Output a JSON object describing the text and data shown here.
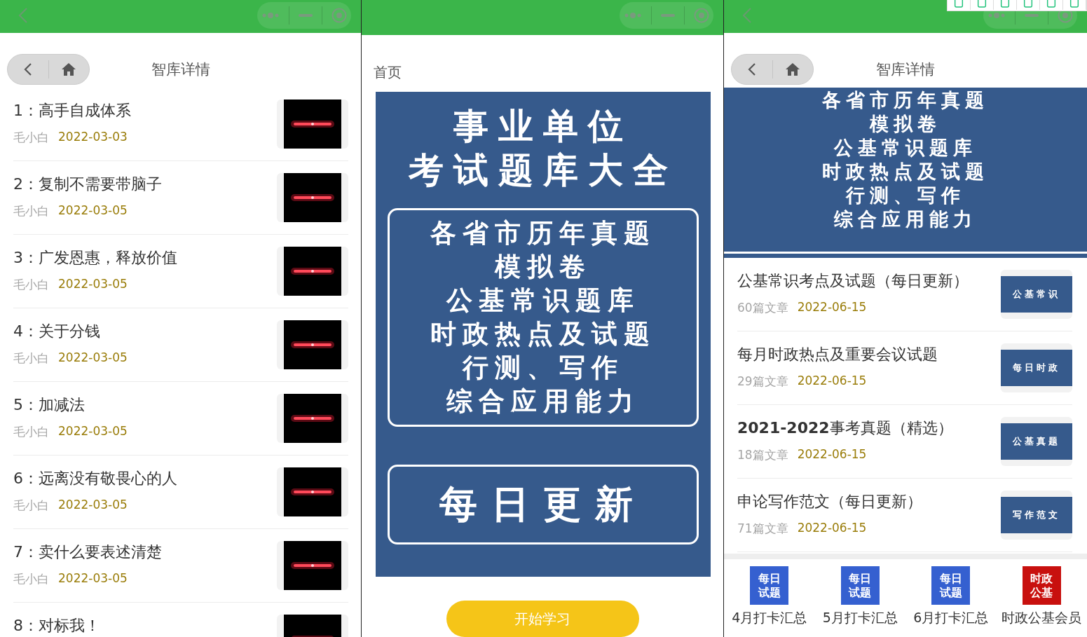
{
  "screens": [
    {
      "kind": "list",
      "nav_title": "智库详情",
      "articles": [
        {
          "title": "1：高手自成体系",
          "author": "毛小白",
          "date": "2022-03-03"
        },
        {
          "title": "2：复制不需要带脑子",
          "author": "毛小白",
          "date": "2022-03-05"
        },
        {
          "title": "3：广发恩惠，释放价值",
          "author": "毛小白",
          "date": "2022-03-05"
        },
        {
          "title": "4：关于分钱",
          "author": "毛小白",
          "date": "2022-03-05"
        },
        {
          "title": "5：加减法",
          "author": "毛小白",
          "date": "2022-03-05"
        },
        {
          "title": "6：远离没有敬畏心的人",
          "author": "毛小白",
          "date": "2022-03-05"
        },
        {
          "title": "7：卖什么要表述清楚",
          "author": "毛小白",
          "date": "2022-03-05"
        },
        {
          "title": "8：对标我！"
        }
      ]
    },
    {
      "kind": "home",
      "page_title": "首页",
      "banner": {
        "headline": [
          "事业单位",
          "考试题库大全"
        ],
        "topics": [
          "各省市历年真题",
          "模拟卷",
          "公基常识题库",
          "时政热点及试题",
          "行测、写作",
          "综合应用能力"
        ],
        "tagline": "每日更新"
      },
      "button": "开始学习"
    },
    {
      "kind": "catalog",
      "nav_title": "智库详情",
      "banner_lines": [
        "各省市历年真题",
        "模拟卷",
        "公基常识题库",
        "时政热点及试题",
        "行测、写作",
        "综合应用能力"
      ],
      "columns": [
        {
          "title": "公基常识考点及试题（每日更新）",
          "count": "60篇文章",
          "date": "2022-06-15",
          "cover": "公基常识"
        },
        {
          "title": "每月时政热点及重要会议试题",
          "count": "29篇文章",
          "date": "2022-06-15",
          "cover": "每日时政"
        },
        {
          "title": "**2021-2022**事考真题（精选）",
          "count": "18篇文章",
          "date": "2022-06-15",
          "cover": "公基真题"
        },
        {
          "title": "申论写作范文（每日更新）",
          "count": "71篇文章",
          "date": "2022-06-15",
          "cover": "写作范文"
        }
      ],
      "shortcuts": [
        {
          "icon_text": [
            "每日",
            "试题"
          ],
          "label": "4月打卡汇总",
          "color": "#3560d0"
        },
        {
          "icon_text": [
            "每日",
            "试题"
          ],
          "label": "5月打卡汇总",
          "color": "#3560d0"
        },
        {
          "icon_text": [
            "每日",
            "试题"
          ],
          "label": "6月打卡汇总",
          "color": "#3560d0"
        },
        {
          "icon_text": [
            "时政",
            "公基"
          ],
          "label": "时政公基会员",
          "color": "#c8100e"
        }
      ]
    }
  ]
}
